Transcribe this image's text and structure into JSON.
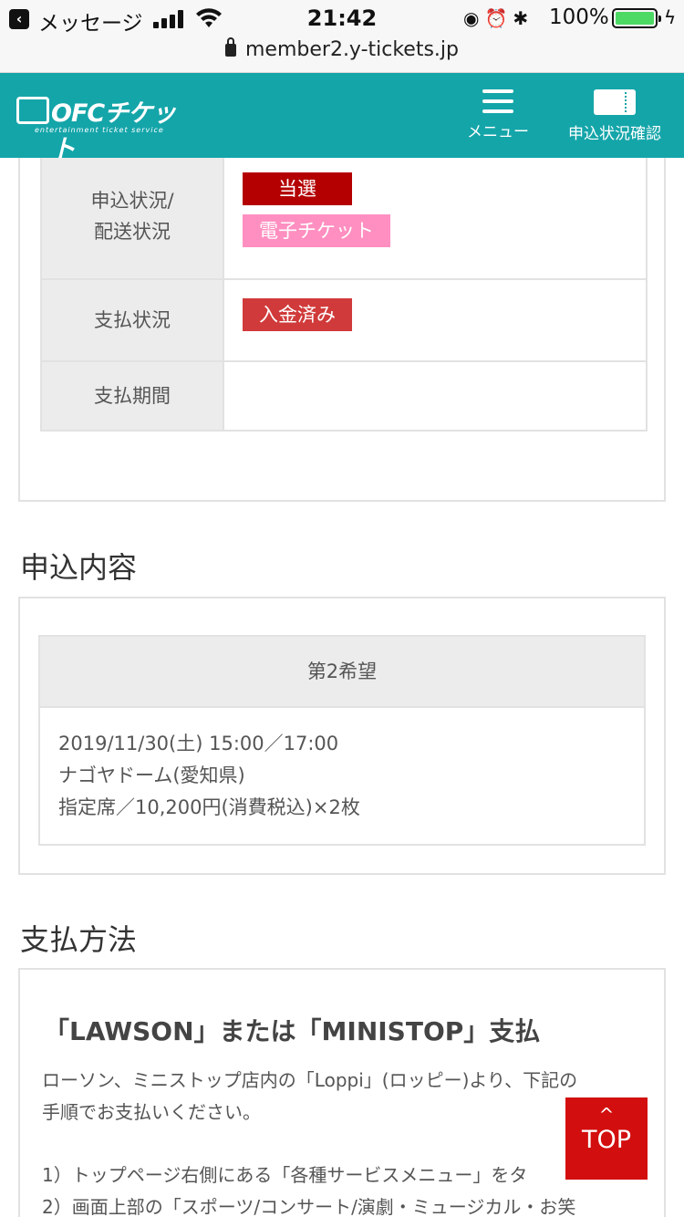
{
  "status_bar": {
    "back_app": "メッセージ",
    "time": "21:42",
    "battery": "100%",
    "url": "member2.y-tickets.jp"
  },
  "header": {
    "logo": "OFCチケット",
    "logo_sub": "entertainment ticket service",
    "menu_label": "メニュー",
    "status_label": "申込状況確認",
    "bg_color": "#14a5a9"
  },
  "status_table": {
    "rows": [
      {
        "label_line1": "申込状況/",
        "label_line2": "配送状況",
        "badges": [
          "当選",
          "電子チケット"
        ]
      },
      {
        "label": "支払状況",
        "badges": [
          "入金済み"
        ]
      },
      {
        "label": "支払期間",
        "value": ""
      }
    ]
  },
  "application": {
    "title": "申込内容",
    "wish_label": "第2希望",
    "lines": [
      "2019/11/30(土) 15:00／17:00",
      "ナゴヤドーム(愛知県)",
      "指定席／10,200円(消費税込)×2枚"
    ]
  },
  "payment": {
    "title": "支払方法",
    "method_title": "「LAWSON」または「MINISTOP」支払",
    "description_line1": "ローソン、ミニストップ店内の「Loppi」(ロッピー)より、下記の",
    "description_line2": "手順でお支払いください。",
    "step1": "1）トップページ右側にある「各種サービスメニュー」をタ",
    "step2": "2）画面上部の「スポーツ/コンサート/演劇・ミュージカル・お笑"
  },
  "top_button": {
    "label": "TOP",
    "arrow": "^"
  }
}
